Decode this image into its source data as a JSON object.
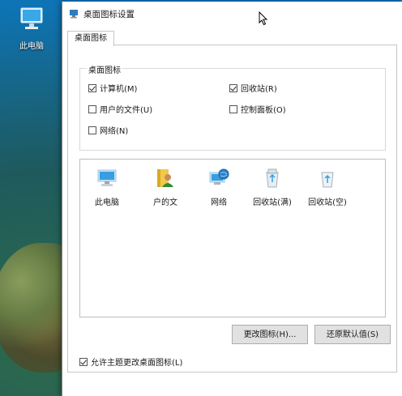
{
  "desktop": {
    "icon_label": "此电脑"
  },
  "window": {
    "title": "桌面图标设置",
    "tab_label": "桌面图标",
    "group_label": "桌面图标",
    "checkboxes": [
      {
        "label": "计算机(M)",
        "checked": true
      },
      {
        "label": "回收站(R)",
        "checked": true
      },
      {
        "label": "用户的文件(U)",
        "checked": false
      },
      {
        "label": "控制面板(O)",
        "checked": false
      },
      {
        "label": "网络(N)",
        "checked": false
      }
    ],
    "icons": [
      {
        "label": "此电脑",
        "icon": "computer-icon"
      },
      {
        "label": "户的文",
        "icon": "user-folder-icon"
      },
      {
        "label": "网络",
        "icon": "network-icon"
      },
      {
        "label": "回收站(满)",
        "icon": "recycle-bin-full-icon"
      },
      {
        "label": "回收站(空)",
        "icon": "recycle-bin-empty-icon"
      }
    ],
    "change_icon_button": "更改图标(H)...",
    "restore_default_button": "还原默认值(S)",
    "allow_theme_label": "允许主题更改桌面图标(L)",
    "allow_theme_checked": true
  }
}
